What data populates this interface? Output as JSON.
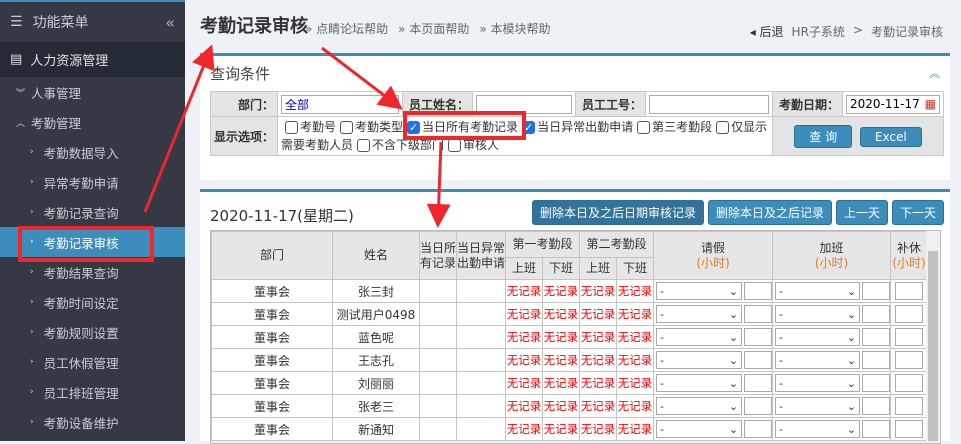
{
  "sidebar": {
    "header": "功能菜单",
    "top": "人力资源管理",
    "groups": [
      "人事管理",
      "考勤管理"
    ],
    "items": [
      "考勤数据导入",
      "异常考勤申请",
      "考勤记录查询",
      "考勤记录审核",
      "考勤结果查询",
      "考勤时间设定",
      "考勤规则设置",
      "员工休假管理",
      "员工排班管理",
      "考勤设备维护"
    ]
  },
  "header": {
    "title": "考勤记录审核",
    "help": [
      "» 点睛论坛帮助",
      "» 本页面帮助",
      "» 本模块帮助"
    ],
    "back": "◂ 后退",
    "crumbs": [
      "HR子系统",
      ">",
      "考勤记录审核"
    ]
  },
  "query": {
    "title": "查询条件",
    "dept_label": "部门：",
    "dept_value": "全部",
    "name_label": "员工姓名：",
    "id_label": "员工工号：",
    "date_label": "考勤日期：",
    "date_value": "2020-11-17",
    "options_label": "显示选项：",
    "options": [
      {
        "label": "考勤号",
        "checked": false
      },
      {
        "label": "考勤类型",
        "checked": false
      },
      {
        "label": "当日所有考勤记录",
        "checked": true
      },
      {
        "label": "当日异常出勤申请",
        "checked": true
      },
      {
        "label": "第三考勤段",
        "checked": false
      },
      {
        "label": "仅显示需要考勤人员",
        "checked": false
      },
      {
        "label": "不含下级部门",
        "checked": false
      },
      {
        "label": "审核人",
        "checked": false
      }
    ],
    "search": "查 询",
    "excel": "Excel"
  },
  "records": {
    "date": "2020-11-17(星期二)",
    "buttons": [
      "删除本日及之后日期审核记录",
      "删除本日及之后记录",
      "上一天",
      "下一天"
    ],
    "headers": {
      "dept": "部门",
      "name": "姓名",
      "all": "当日所有记录",
      "abn": "当日异常出勤申请",
      "seg1": "第一考勤段",
      "seg2": "第二考勤段",
      "on": "上班",
      "off": "下班",
      "leave": "请假",
      "ot": "加班",
      "comp": "补休",
      "unit": "(小时)"
    },
    "no_record": "无记录",
    "dash": "-",
    "rows": [
      {
        "dept": "董事会",
        "name": "张三封"
      },
      {
        "dept": "董事会",
        "name": "测试用户0498"
      },
      {
        "dept": "董事会",
        "name": "蓝色呢"
      },
      {
        "dept": "董事会",
        "name": "王志孔"
      },
      {
        "dept": "董事会",
        "name": "刘丽丽"
      },
      {
        "dept": "董事会",
        "name": "张老三"
      },
      {
        "dept": "董事会",
        "name": "新通知"
      }
    ]
  }
}
